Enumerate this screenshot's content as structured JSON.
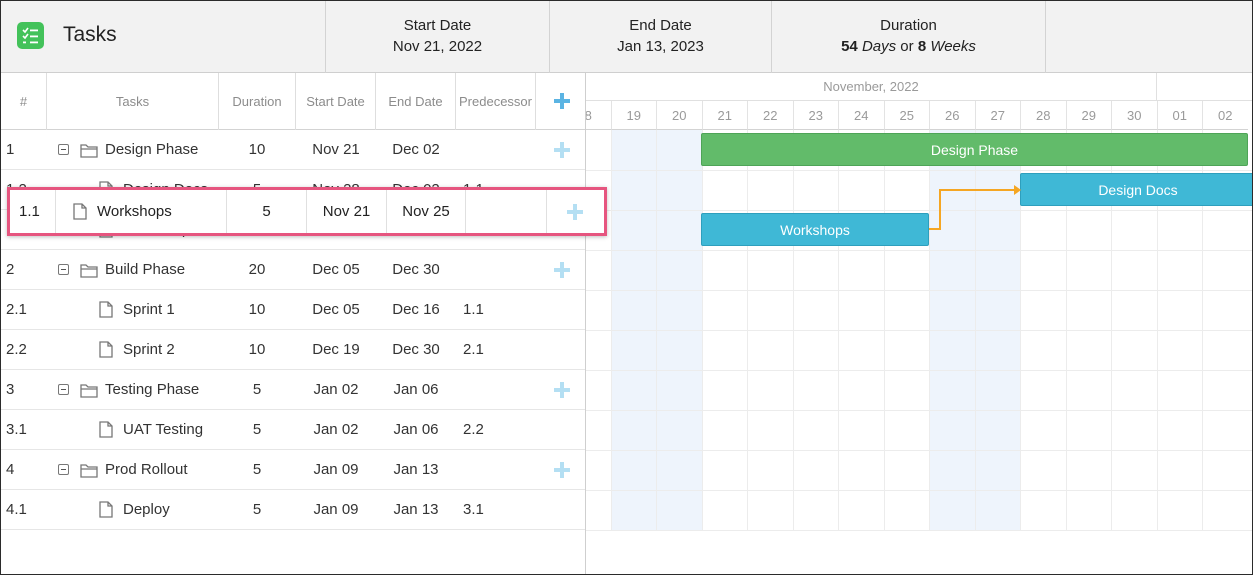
{
  "header": {
    "title": "Tasks",
    "start_label": "Start Date",
    "start_value": "Nov 21, 2022",
    "end_label": "End Date",
    "end_value": "Jan 13, 2023",
    "duration_label": "Duration",
    "duration_days": "54",
    "duration_days_unit": " Days",
    "duration_or": " or ",
    "duration_weeks": "8",
    "duration_weeks_unit": " Weeks"
  },
  "columns": {
    "num": "#",
    "tasks": "Tasks",
    "duration": "Duration",
    "start": "Start Date",
    "end": "End Date",
    "pred": "Predecessor"
  },
  "rows": [
    {
      "num": "1",
      "name": "Design Phase",
      "duration": "10",
      "start": "Nov 21",
      "end": "Dec 02",
      "pred": ""
    },
    {
      "num": "1.2",
      "name": "Design Docs",
      "duration": "5",
      "start": "Nov 28",
      "end": "Dec 02",
      "pred": "1.1"
    },
    {
      "num": "1.1",
      "name": "Workshops",
      "duration": "5",
      "start": "Nov 21",
      "end": "Nov 25",
      "pred": ""
    },
    {
      "num": "2",
      "name": "Build Phase",
      "duration": "20",
      "start": "Dec 05",
      "end": "Dec 30",
      "pred": ""
    },
    {
      "num": "2.1",
      "name": "Sprint 1",
      "duration": "10",
      "start": "Dec 05",
      "end": "Dec 16",
      "pred": "1.1"
    },
    {
      "num": "2.2",
      "name": "Sprint 2",
      "duration": "10",
      "start": "Dec 19",
      "end": "Dec 30",
      "pred": "2.1"
    },
    {
      "num": "3",
      "name": "Testing Phase",
      "duration": "5",
      "start": "Jan 02",
      "end": "Jan 06",
      "pred": ""
    },
    {
      "num": "3.1",
      "name": "UAT Testing",
      "duration": "5",
      "start": "Jan 02",
      "end": "Jan 06",
      "pred": "2.2"
    },
    {
      "num": "4",
      "name": "Prod Rollout",
      "duration": "5",
      "start": "Jan 09",
      "end": "Jan 13",
      "pred": ""
    },
    {
      "num": "4.1",
      "name": "Deploy",
      "duration": "5",
      "start": "Jan 09",
      "end": "Jan 13",
      "pred": "3.1"
    }
  ],
  "drag_row": {
    "num": "1.1",
    "name": "Workshops",
    "duration": "5",
    "start": "Nov 21",
    "end": "Nov 25"
  },
  "timeline": {
    "month": "November, 2022",
    "days": [
      "8",
      "19",
      "20",
      "21",
      "22",
      "23",
      "24",
      "25",
      "26",
      "27",
      "28",
      "29",
      "30",
      "01",
      "02"
    ],
    "bars": {
      "design_phase": "Design Phase",
      "design_docs": "Design Docs",
      "workshops": "Workshops"
    }
  },
  "colors": {
    "phase_bar": "#62bb6a",
    "task_bar": "#3fb8d6",
    "dependency_arrow": "#f5a623",
    "drag_highlight": "#e6557f",
    "add_icon": "#7fc8ea"
  },
  "icons": {
    "app": "checklist-icon",
    "phase": "folder-icon",
    "task": "document-icon",
    "add": "plus-icon",
    "collapse": "minus-square-icon"
  }
}
